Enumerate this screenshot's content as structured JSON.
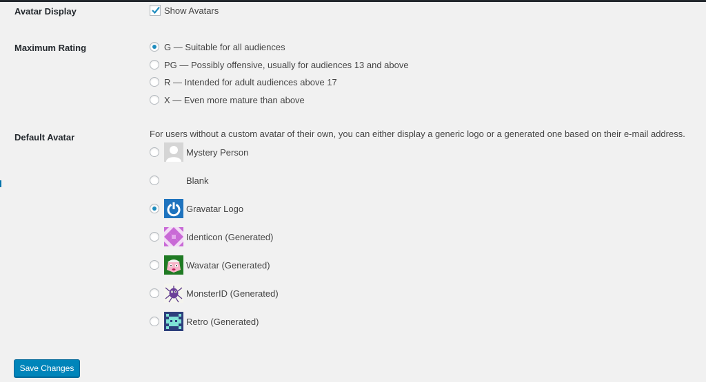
{
  "avatar_display": {
    "label": "Avatar Display",
    "checkbox_label": "Show Avatars",
    "checked": true
  },
  "maximum_rating": {
    "label": "Maximum Rating",
    "options": [
      {
        "label": "G — Suitable for all audiences",
        "selected": true
      },
      {
        "label": "PG — Possibly offensive, usually for audiences 13 and above",
        "selected": false
      },
      {
        "label": "R — Intended for adult audiences above 17",
        "selected": false
      },
      {
        "label": "X — Even more mature than above",
        "selected": false
      }
    ]
  },
  "default_avatar": {
    "label": "Default Avatar",
    "description": "For users without a custom avatar of their own, you can either display a generic logo or a generated one based on their e-mail address.",
    "options": [
      {
        "label": "Mystery Person",
        "icon": "mystery-person-icon",
        "selected": false
      },
      {
        "label": "Blank",
        "icon": "blank-icon",
        "selected": false
      },
      {
        "label": "Gravatar Logo",
        "icon": "gravatar-logo-icon",
        "selected": true
      },
      {
        "label": "Identicon (Generated)",
        "icon": "identicon-icon",
        "selected": false
      },
      {
        "label": "Wavatar (Generated)",
        "icon": "wavatar-icon",
        "selected": false
      },
      {
        "label": "MonsterID (Generated)",
        "icon": "monsterid-icon",
        "selected": false
      },
      {
        "label": "Retro (Generated)",
        "icon": "retro-icon",
        "selected": false
      }
    ]
  },
  "save_button": {
    "label": "Save Changes"
  },
  "colors": {
    "accent": "#0085ba",
    "radio_dot": "#1e8cbe",
    "background": "#f1f1f1"
  }
}
